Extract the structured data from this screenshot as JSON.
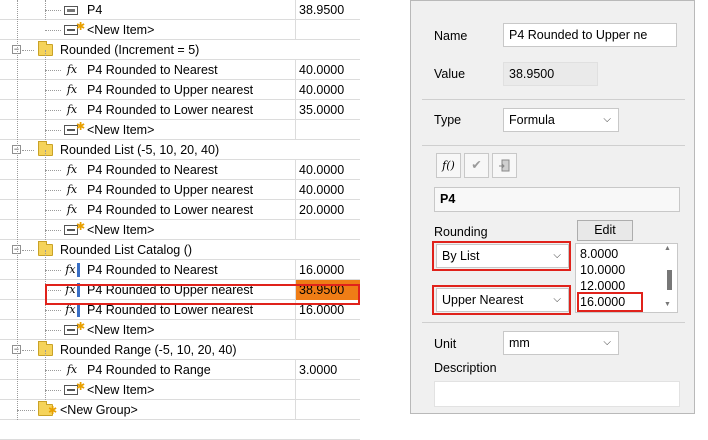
{
  "tree": {
    "rows": [
      {
        "kind": "param",
        "label": "P4",
        "value": "38.9500"
      },
      {
        "kind": "newitem",
        "label": "<New Item>",
        "value": ""
      },
      {
        "kind": "group",
        "label": "Rounded (Increment = 5)",
        "value": ""
      },
      {
        "kind": "fx",
        "label": "P4 Rounded to Nearest",
        "value": "40.0000"
      },
      {
        "kind": "fx",
        "label": "P4 Rounded to Upper nearest",
        "value": "40.0000"
      },
      {
        "kind": "fx",
        "label": "P4 Rounded to Lower nearest",
        "value": "35.0000"
      },
      {
        "kind": "newitem",
        "label": "<New Item>",
        "value": ""
      },
      {
        "kind": "group",
        "label": "Rounded List (-5, 10, 20, 40)",
        "value": ""
      },
      {
        "kind": "fx",
        "label": "P4 Rounded to Nearest",
        "value": "40.0000"
      },
      {
        "kind": "fx",
        "label": "P4 Rounded to Upper nearest",
        "value": "40.0000"
      },
      {
        "kind": "fx",
        "label": "P4 Rounded to Lower nearest",
        "value": "20.0000"
      },
      {
        "kind": "newitem",
        "label": "<New Item>",
        "value": ""
      },
      {
        "kind": "group",
        "label": "Rounded List Catalog ()",
        "value": ""
      },
      {
        "kind": "fxlist",
        "label": "P4 Rounded to Nearest",
        "value": "16.0000"
      },
      {
        "kind": "fxlist",
        "label": "P4 Rounded to Upper nearest",
        "value": "38.9500",
        "selected": true
      },
      {
        "kind": "fxlist",
        "label": "P4 Rounded to Lower nearest",
        "value": "16.0000"
      },
      {
        "kind": "newitem",
        "label": "<New Item>",
        "value": ""
      },
      {
        "kind": "group",
        "label": "Rounded Range (-5, 10, 20, 40)",
        "value": ""
      },
      {
        "kind": "fx",
        "label": "P4 Rounded to Range",
        "value": "3.0000"
      },
      {
        "kind": "newitem",
        "label": "<New Item>",
        "value": ""
      },
      {
        "kind": "newgroup",
        "label": "<New Group>",
        "value": ""
      }
    ]
  },
  "panel": {
    "name_label": "Name",
    "name_value": "P4 Rounded to Upper ne",
    "value_label": "Value",
    "value_value": "38.9500",
    "type_label": "Type",
    "type_value": "Formula",
    "formula_text": "P4",
    "formula_btn_label": "f()",
    "check_btn_label": "✔",
    "rounding_label": "Rounding",
    "edit_label": "Edit",
    "rounding_mode": "By List",
    "rounding_direction": "Upper Nearest",
    "list_items": [
      "8.0000",
      "10.0000",
      "12.0000",
      "16.0000"
    ],
    "unit_label": "Unit",
    "unit_value": "mm",
    "description_label": "Description",
    "description_value": ""
  },
  "colors": {
    "highlight": "#ef7d16",
    "annotation": "#e0221b"
  }
}
